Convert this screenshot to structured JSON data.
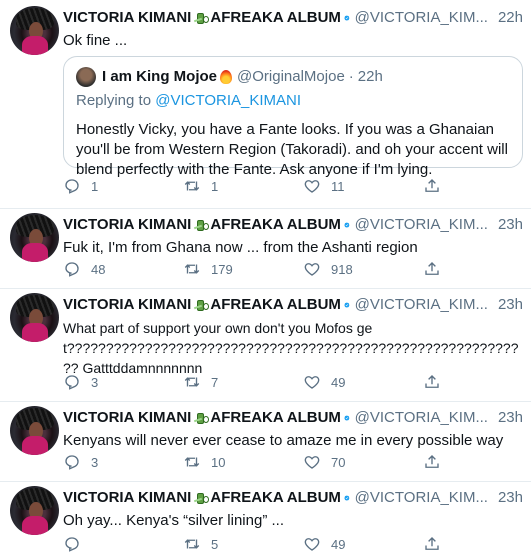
{
  "author": {
    "name": "VICTORIA KIMANI",
    "album": "AFREAKA ALBUM",
    "handle": "@VICTORIA_KIM..."
  },
  "quote": {
    "name": "I am King Mojoe",
    "handle": "@OriginalMojoe",
    "time": "22h",
    "replying_prefix": "Replying to",
    "replying_handle": "@VICTORIA_KIMANI",
    "text": "Honestly Vicky, you have a Fante looks. If you was a Ghanaian you'll be from Western Region (Takoradi). and oh your accent will blend perfectly with the Fante. Ask anyone if I'm lying."
  },
  "tweets": [
    {
      "time": "22h",
      "text": "Ok fine ...",
      "replies": "1",
      "retweets": "1",
      "likes": "11"
    },
    {
      "time": "23h",
      "text": "Fuk it, I'm from Ghana now ... from the Ashanti region",
      "replies": "48",
      "retweets": "179",
      "likes": "918"
    },
    {
      "time": "23h",
      "text": "What part of support your own don't you Mofos get???????????????????????????????????????????????????????????? Gatttddamnnnnnnn",
      "replies": "3",
      "retweets": "7",
      "likes": "49"
    },
    {
      "time": "23h",
      "text": "Kenyans will never ever cease to amaze me in every possible way",
      "replies": "3",
      "retweets": "10",
      "likes": "70"
    },
    {
      "time": "23h",
      "text": "Oh yay... Kenya's “silver lining” ...",
      "replies": "",
      "retweets": "5",
      "likes": "49"
    }
  ],
  "icons": {
    "reply": "reply-icon",
    "retweet": "retweet-icon",
    "like": "heart-icon",
    "share": "share-icon",
    "verified": "verified-badge-icon",
    "money": "money-with-wings-emoji",
    "fire": "fire-emoji",
    "more": "more-icon"
  },
  "colors": {
    "verified": "#1da1f2",
    "secondary_text": "#5b7083",
    "link": "#1b95e0",
    "divider": "#e6ecf0"
  }
}
